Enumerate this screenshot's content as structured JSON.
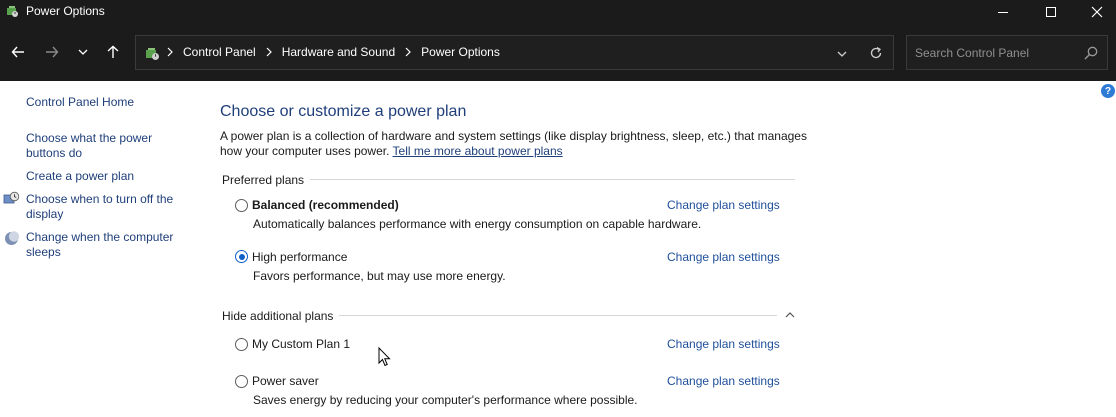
{
  "window": {
    "title": "Power Options"
  },
  "address": {
    "crumbs": [
      "Control Panel",
      "Hardware and Sound",
      "Power Options"
    ]
  },
  "search": {
    "placeholder": "Search Control Panel"
  },
  "left_pane": {
    "items": [
      {
        "label": "Control Panel Home"
      },
      {
        "label": "Choose what the power buttons do"
      },
      {
        "label": "Create a power plan"
      },
      {
        "label": "Choose when to turn off the display",
        "icon": "monitor-clock-icon"
      },
      {
        "label": "Change when the computer sleeps",
        "icon": "moon-sleep-icon"
      }
    ]
  },
  "main": {
    "title": "Choose or customize a power plan",
    "intro_text": "A power plan is a collection of hardware and system settings (like display brightness, sleep, etc.) that manages how your computer uses power.",
    "intro_link": "Tell me more about power plans",
    "preferred_label": "Preferred plans",
    "additional_label": "Hide additional plans",
    "change_label": "Change plan settings",
    "plans": [
      {
        "name": "Balanced (recommended)",
        "description": "Automatically balances performance with energy consumption on capable hardware.",
        "selected": false
      },
      {
        "name": "High performance",
        "description": "Favors performance, but may use more energy.",
        "selected": true
      },
      {
        "name": "My Custom Plan 1",
        "description": "",
        "selected": false
      },
      {
        "name": "Power saver",
        "description": "Saves energy by reducing your computer's performance where possible.",
        "selected": false
      }
    ]
  },
  "colors": {
    "titlebar_bg": "#1b1b1b",
    "link_blue": "#1f3f7a",
    "radio_selected": "#0f5fc9",
    "help_blue": "#2e7bd6"
  }
}
